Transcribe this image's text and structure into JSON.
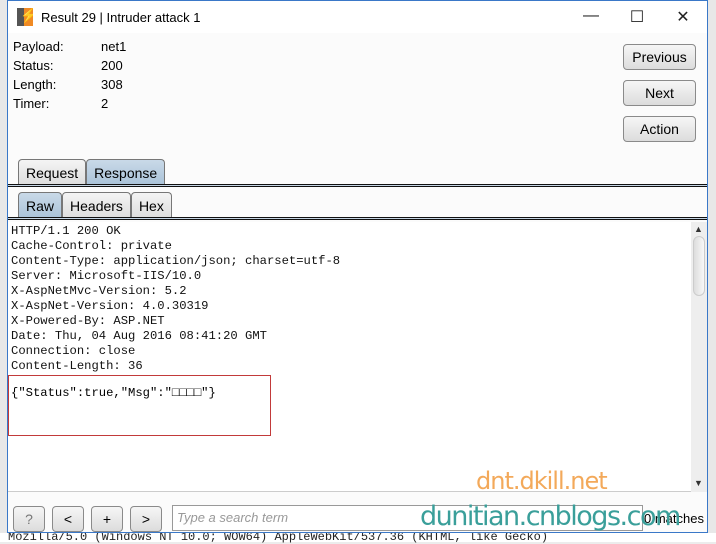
{
  "window": {
    "title": "Result 29 | Intruder attack 1",
    "minimize": "—",
    "maximize": "☐",
    "close": "✕"
  },
  "info": [
    {
      "k": "Payload:",
      "v": "net1"
    },
    {
      "k": "Status:",
      "v": "200"
    },
    {
      "k": "Length:",
      "v": "308"
    },
    {
      "k": "Timer:",
      "v": "2"
    }
  ],
  "buttons": {
    "previous": "Previous",
    "next": "Next",
    "action": "Action"
  },
  "tabs": [
    "Request",
    "Response"
  ],
  "selected_tab": "Response",
  "subtabs": [
    "Raw",
    "Headers",
    "Hex"
  ],
  "selected_subtab": "Raw",
  "response": {
    "headers": "HTTP/1.1 200 OK\nCache-Control: private\nContent-Type: application/json; charset=utf-8\nServer: Microsoft-IIS/10.0\nX-AspNetMvc-Version: 5.2\nX-AspNet-Version: 4.0.30319\nX-Powered-By: ASP.NET\nDate: Thu, 04 Aug 2016 08:41:20 GMT\nConnection: close\nContent-Length: 36",
    "body": "{\"Status\":true,\"Msg\":\"□□□□\"}"
  },
  "search": {
    "help": "?",
    "prev": "<",
    "add": "+",
    "next": ">",
    "placeholder": "Type a search term",
    "matches": "0 matches"
  },
  "watermark": {
    "line1": "dnt.dkill.net",
    "line2": "dunitian.cnblogs.com"
  },
  "background_text": "Mozilla/5.0 (Windows NT 10.0; WOW64) AppleWebKit/537.36 (KHTML, like Gecko)"
}
